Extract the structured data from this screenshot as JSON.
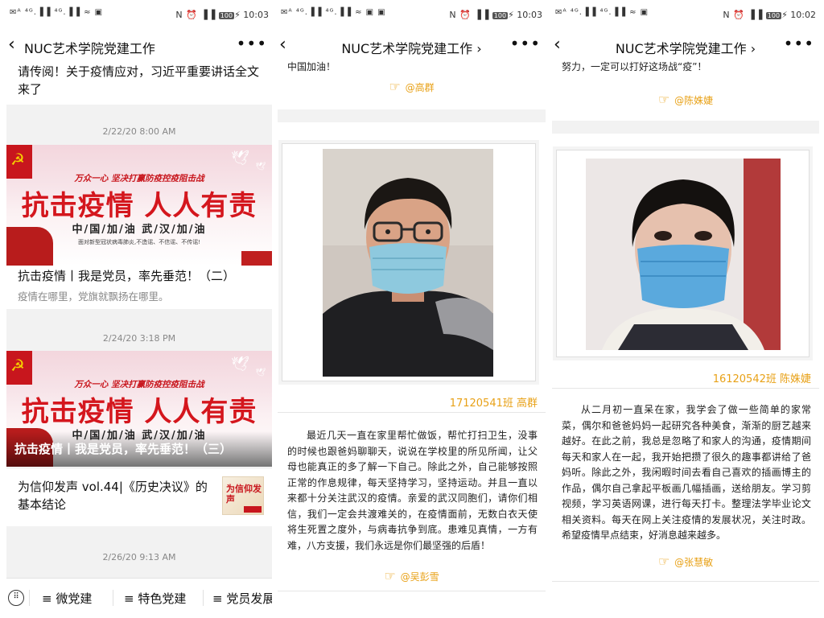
{
  "panels": [
    {
      "status": {
        "left": "✉ᴬ ⁴ᴳ.▐▐ ⁴ᴳ.▐▐ ≈ ▣",
        "nfc": "N",
        "alarm": "⏰",
        "vib": "▐▐",
        "battery": "100",
        "bolt": "⚡",
        "time": "10:03"
      },
      "nav": {
        "back": "‹",
        "title": "NUC艺术学院党建工作",
        "more": "•••"
      },
      "feed": {
        "top_title": "请传阅！关于疫情应对，习近平重要讲话全文来了",
        "date1": "2/22/20 8:00 AM",
        "banner": {
          "slogan": "万众一心  坚决打赢防疫控疫阻击战",
          "big": "抗击疫情  人人有责",
          "cheer": "中/国/加/油  武/汉/加/油",
          "small": "面对新型冠状病毒肺炎,不造谣、不信谣、不传谣!"
        },
        "article1_title": "抗击疫情丨我是党员，率先垂范！（二）",
        "article1_sub": "疫情在哪里，党旗就飘扬在哪里。",
        "date2": "2/24/20 3:18 PM",
        "article2_title": "抗击疫情丨我是党员，率先垂范！（三）",
        "article3_title": "为信仰发声 vol.44|《历史决议》的基本结论",
        "thumb_text": "为信仰发声",
        "date3": "2/26/20 9:13 AM"
      },
      "menu": [
        "≡ 微党建",
        "≡ 特色党建",
        "≡ 党员发展"
      ]
    },
    {
      "status": {
        "left": "✉ᴬ ⁴ᴳ.▐▐ ⁴ᴳ.▐▐ ≈ ▣ ▣",
        "nfc": "N",
        "alarm": "⏰",
        "vib": "▐▐",
        "battery": "100",
        "bolt": "⚡",
        "time": "10:03"
      },
      "nav": {
        "back": "‹",
        "title": "NUC艺术学院党建工作 ›",
        "more": "•••"
      },
      "top_text": "中国加油！",
      "sign1": "@高群",
      "caption": "17120541班 高群",
      "paragraph": "最近几天一直在家里帮忙做饭，帮忙打扫卫生，没事的时候也跟爸妈聊聊天，说说在学校里的所见所闻，让父母也能真正的多了解一下自己。除此之外，自己能够按照正常的作息规律，每天坚持学习，坚持运动。并且一直以来都十分关注武汉的疫情。亲爱的武汉同胞们，请你们相信，我们一定会共渡难关的，在疫情面前，无数白衣天使将生死置之度外，与病毒抗争到底。患难见真情，一方有难，八方支援，我们永远是你们最坚强的后盾！",
      "sign2": "@吴彭雪"
    },
    {
      "status": {
        "left": "✉ᴬ ⁴ᴳ.▐▐ ⁴ᴳ.▐▐ ≈ ▣",
        "nfc": "N",
        "alarm": "⏰",
        "vib": "▐▐",
        "battery": "100",
        "bolt": "⚡",
        "time": "10:02"
      },
      "nav": {
        "back": "‹",
        "title": "NUC艺术学院党建工作 ›",
        "more": "•••"
      },
      "top_text": "努力，一定可以打好这场战“疫”！",
      "sign1": "@陈姝婕",
      "caption": "16120542班 陈姝婕",
      "paragraph": "从二月初一直呆在家，我学会了做一些简单的家常菜，偶尔和爸爸妈妈一起研究各种美食，渐渐的厨艺越来越好。在此之前，我总是忽略了和家人的沟通，疫情期间每天和家人在一起，我开始把攒了很久的趣事都讲给了爸妈听。除此之外，我闲暇时间去看自己喜欢的插画博主的作品，偶尔自己拿起平板画几幅插画，送给朋友。学习剪视频，学习英语网课，进行每天打卡。整理法学毕业论文相关资料。每天在网上关注疫情的发展状况，关注时政。希望疫情早点结束，好消息越来越多。",
      "sign2": "@张慧敏"
    }
  ]
}
